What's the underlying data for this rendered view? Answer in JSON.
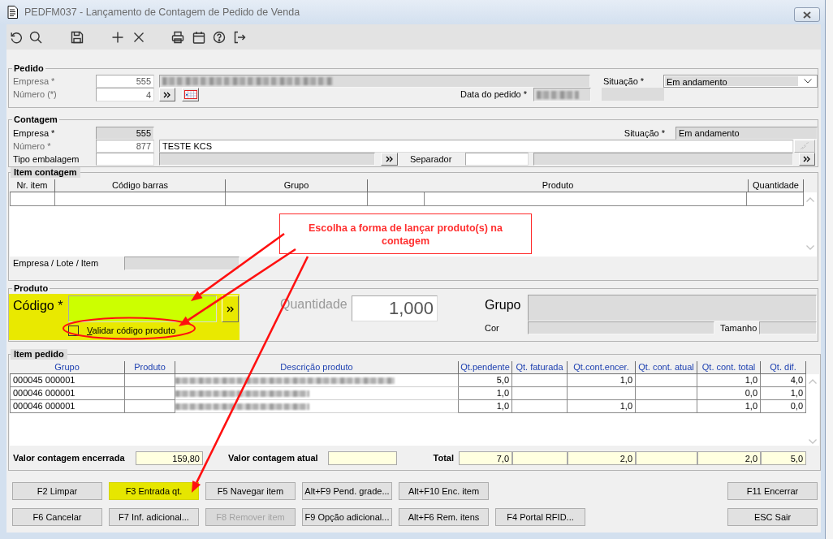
{
  "window": {
    "title": "PEDFM037 - Lançamento de Contagem de Pedido de Venda"
  },
  "pedido": {
    "legend": "Pedido",
    "empresa": {
      "label": "Empresa *",
      "value": "555",
      "disabled": true,
      "readonly": false
    },
    "numero": {
      "label": "Número (*)",
      "value": "4",
      "disabled": true,
      "readonly": false
    },
    "data_pedido": {
      "label": "Data do pedido *"
    },
    "situacao": {
      "label": "Situação *",
      "value": "Em andamento"
    }
  },
  "contagem": {
    "legend": "Contagem",
    "empresa": {
      "label": "Empresa *",
      "value": "555",
      "disabled": false,
      "readonly": true
    },
    "situacao": {
      "label": "Situação *",
      "value": "Em andamento"
    },
    "numero": {
      "label": "Número *",
      "value": "877",
      "disabled": true,
      "readonly": false
    },
    "descricao": {
      "value": "TESTE KCS"
    },
    "tipo_embalagem": {
      "label": "Tipo embalagem"
    },
    "separador": {
      "label": "Separador"
    }
  },
  "item_contagem": {
    "legend": "Item contagem",
    "columns": [
      "Nr. item",
      "Código barras",
      "Grupo",
      "Produto",
      "Quantidade"
    ],
    "lote": {
      "label": "Empresa / Lote / Item"
    }
  },
  "callout": {
    "text": "Escolha a forma de lançar produto(s) na contagem"
  },
  "produto": {
    "legend": "Produto",
    "codigo": {
      "label": "Código *",
      "highlighted": true
    },
    "validar": {
      "label": "Validar código produto",
      "checked": false
    },
    "quantidade": {
      "label": "Quantidade",
      "value": "1,000",
      "disabled": true
    },
    "grupo": {
      "label": "Grupo"
    },
    "cor": {
      "label": "Cor"
    },
    "tamanho": {
      "label": "Tamanho"
    }
  },
  "item_pedido": {
    "legend": "Item pedido",
    "columns": [
      {
        "label": "Grupo",
        "kind": "text"
      },
      {
        "label": "Produto",
        "kind": "text"
      },
      {
        "label": "Descrição produto",
        "kind": "redacted"
      },
      {
        "label": "Qt.pendente",
        "kind": "number"
      },
      {
        "label": "Qt. faturada",
        "kind": "number"
      },
      {
        "label": "Qt.cont.encer.",
        "kind": "number"
      },
      {
        "label": "Qt. cont. atual",
        "kind": "number"
      },
      {
        "label": "Qt. cont. total",
        "kind": "number"
      },
      {
        "label": "Qt. dif.",
        "kind": "number"
      }
    ],
    "rows": [
      {
        "grupo": "000045 000001",
        "qt_pendente": "5,0",
        "qt_cont_encer": "1,0",
        "qt_cont_total": "1,0",
        "qt_dif": "4,0"
      },
      {
        "grupo": "000046 000001",
        "qt_pendente": "1,0",
        "qt_cont_total": "0,0",
        "qt_dif": "1,0"
      },
      {
        "grupo": "000046 000001",
        "qt_pendente": "1,0",
        "qt_cont_encer": "1,0",
        "qt_cont_total": "1,0",
        "qt_dif": "0,0"
      }
    ],
    "valor_encerrada": {
      "label": "Valor contagem encerrada",
      "value": "159,80"
    },
    "valor_atual": {
      "label": "Valor contagem atual"
    },
    "total": {
      "label": "Total",
      "values": {
        "qt_pendente": "7,0",
        "qt_cont_encer": "2,0",
        "qt_cont_total": "2,0",
        "qt_dif": "5,0"
      }
    }
  },
  "buttons": {
    "rows": [
      {
        "left": [
          {
            "label": "F2 Limpar",
            "highlighted": false,
            "disabled": false
          },
          {
            "label": "F3 Entrada qt.",
            "highlighted": true,
            "disabled": false
          },
          {
            "label": "F5 Navegar item",
            "highlighted": false,
            "disabled": false
          },
          {
            "label": "Alt+F9 Pend. grade...",
            "highlighted": false,
            "disabled": false
          },
          {
            "label": "Alt+F10 Enc. item",
            "highlighted": false,
            "disabled": false
          }
        ],
        "right": [
          {
            "label": "F11 Encerrar",
            "highlighted": false,
            "disabled": false
          }
        ]
      },
      {
        "left": [
          {
            "label": "F6 Cancelar",
            "highlighted": false,
            "disabled": false
          },
          {
            "label": "F7 Inf. adicional...",
            "highlighted": false,
            "disabled": false
          },
          {
            "label": "F8 Remover item",
            "highlighted": false,
            "disabled": true
          },
          {
            "label": "F9 Opção adicional...",
            "highlighted": false,
            "disabled": false
          },
          {
            "label": "Alt+F6 Rem. itens",
            "highlighted": false,
            "disabled": false
          },
          {
            "label": "F4 Portal RFID...",
            "highlighted": false,
            "disabled": false
          }
        ],
        "right": [
          {
            "label": "ESC Sair",
            "highlighted": false,
            "disabled": false
          }
        ]
      }
    ]
  }
}
